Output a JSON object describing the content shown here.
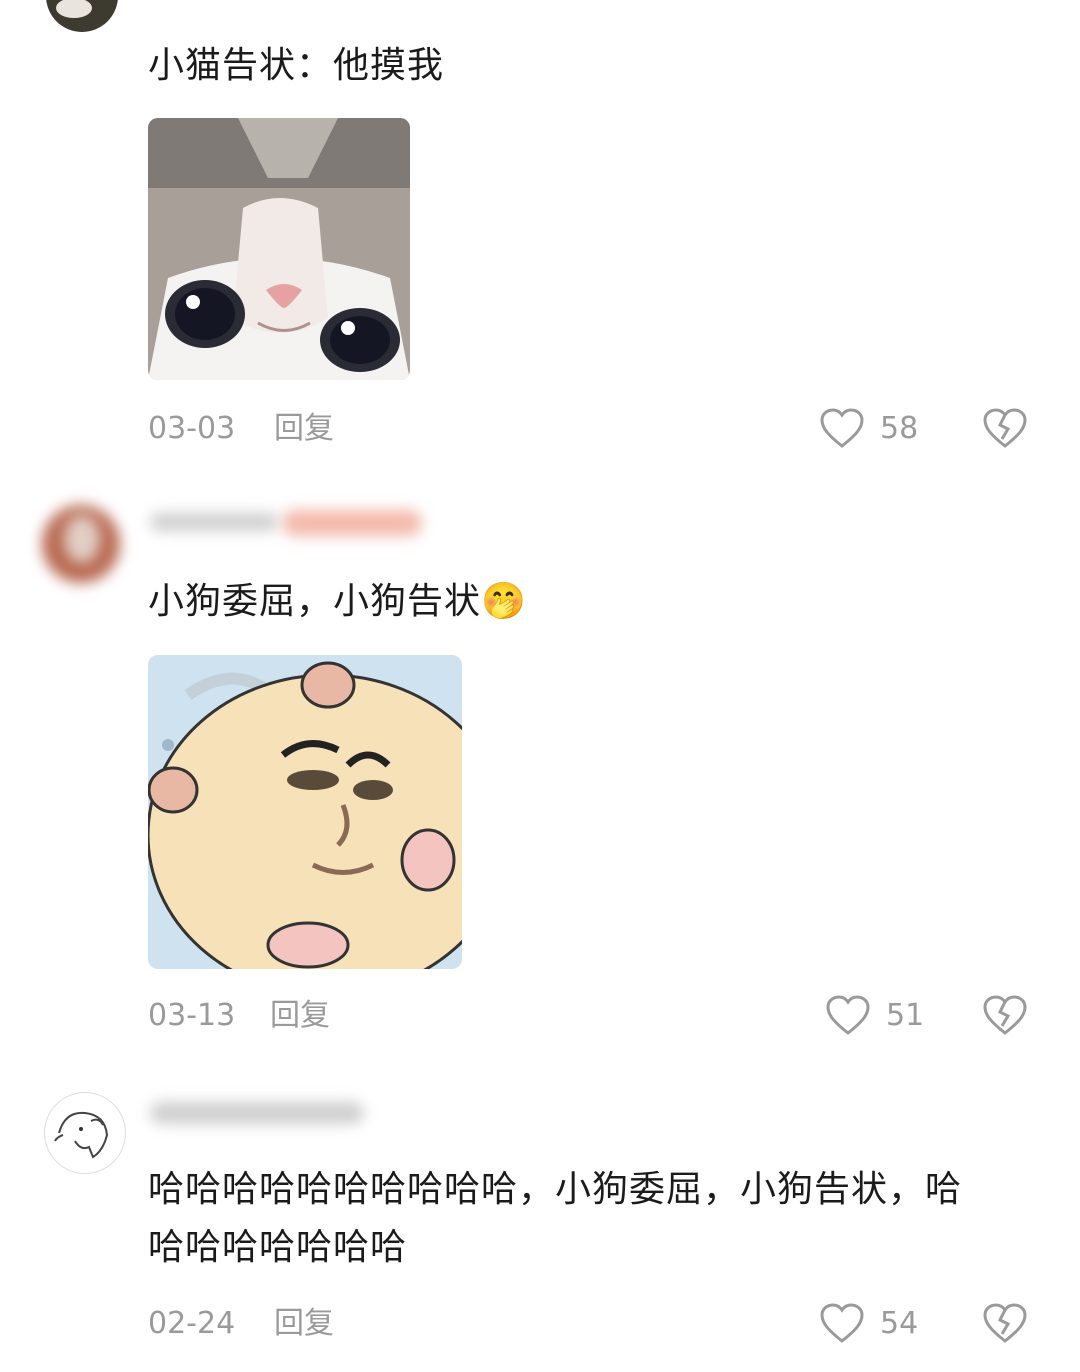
{
  "comments": [
    {
      "text": "小猫告状：他摸我",
      "date": "03-03",
      "reply_label": "回复",
      "likes": "58",
      "image": "crying-cat-meme"
    },
    {
      "text": "小狗委屈，小狗告状",
      "emoji": "🤭",
      "date": "03-13",
      "reply_label": "回复",
      "likes": "51",
      "image": "hamster-face-meme"
    },
    {
      "text_line1": "哈哈哈哈哈哈哈哈哈哈，小狗委屈，小狗告状，哈",
      "text_line2": "哈哈哈哈哈哈哈",
      "date": "02-24",
      "reply_label": "回复",
      "likes": "54",
      "avatar": "dog-sketch-avatar"
    }
  ],
  "icons": {
    "like": "heart-outline-icon",
    "dislike": "broken-heart-icon"
  },
  "colors": {
    "text": "#1b1b1b",
    "meta": "#9a9a9a",
    "blur_accent": "#f3b9aa"
  }
}
